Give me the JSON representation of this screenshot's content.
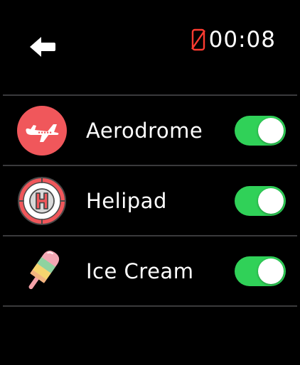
{
  "status": {
    "time": "00:08"
  },
  "colors": {
    "accent_toggle": "#30d158",
    "icon_red": "#f0575b",
    "status_red": "#ff3b30",
    "divider": "#3a3a3c"
  },
  "icons": {
    "back": "back-arrow-icon",
    "status": "phone-disconnected-icon"
  },
  "rows": [
    {
      "label": "Aerodrome",
      "icon": "airplane-icon",
      "enabled": true
    },
    {
      "label": "Helipad",
      "icon": "helipad-icon",
      "enabled": true
    },
    {
      "label": "Ice Cream",
      "icon": "ice-cream-icon",
      "enabled": true
    }
  ]
}
